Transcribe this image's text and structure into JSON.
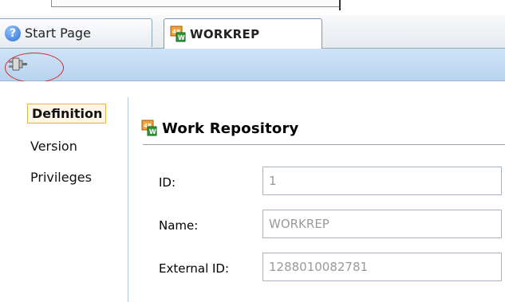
{
  "tabs": [
    {
      "label": "Start Page",
      "icon": "help-icon",
      "active": false
    },
    {
      "label": "WORKREP",
      "icon": "work-repository-icon",
      "active": true
    }
  ],
  "toolbar": {
    "connect_icon": "connect-plug-icon"
  },
  "left_tabs": [
    {
      "label": "Definition",
      "active": true
    },
    {
      "label": "Version",
      "active": false
    },
    {
      "label": "Privileges",
      "active": false
    }
  ],
  "section": {
    "title": "Work Repository",
    "icon": "work-repository-icon"
  },
  "fields": [
    {
      "label": "ID:",
      "value": "1"
    },
    {
      "label": "Name:",
      "value": "WORKREP"
    },
    {
      "label": "External ID:",
      "value": "1288010082781"
    }
  ],
  "colors": {
    "highlight_ring": "#d8262b",
    "active_tab_border": "#e7b14b",
    "toolbar": "#c3dbf2"
  }
}
